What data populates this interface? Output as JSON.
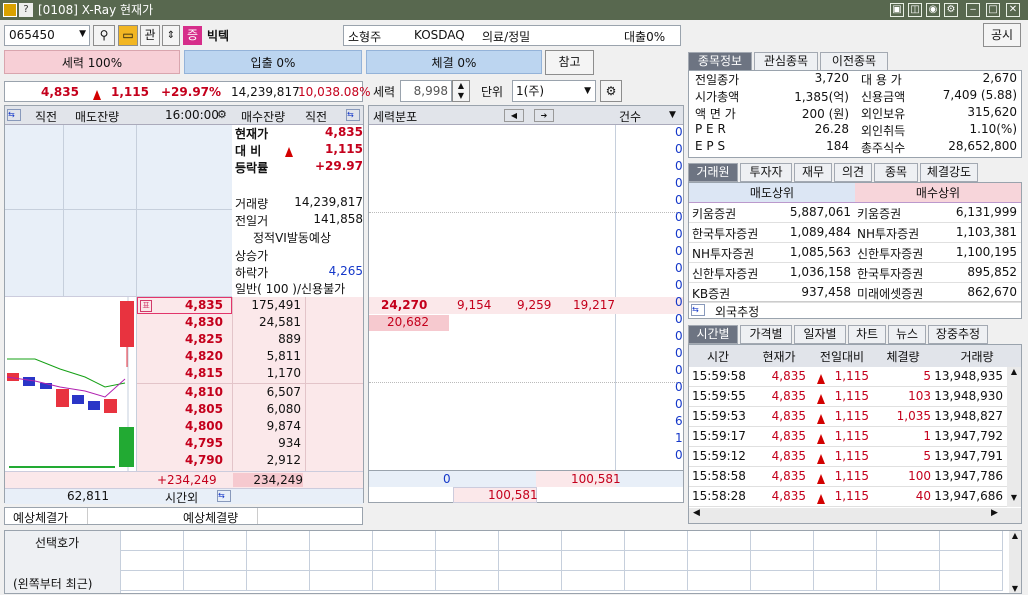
{
  "window": {
    "title": "[0108] X-Ray 현재가",
    "icon_q": "?"
  },
  "toolbar": {
    "code": "065450",
    "gwan": "관",
    "jeung": "증",
    "name": "빅텍",
    "size": "소형주",
    "market": "KOSDAQ",
    "sector": "의료/정밀",
    "loan": "대출0%",
    "notice_btn": "공시"
  },
  "bars": {
    "force": "세력 100%",
    "inout": "입출 0%",
    "fill": "체결 0%",
    "ref": "참고"
  },
  "price_line": {
    "price": "4,835",
    "change": "1,115",
    "rate": "+29.97%",
    "volume": "14,239,817",
    "vol_ratio": "10,038.08%"
  },
  "force_ctrl": {
    "label": "세력",
    "value": "8,998",
    "unit_label": "단위",
    "unit": "1(주)"
  },
  "orderbook": {
    "headers": {
      "prev_l": "직전",
      "sell_rem": "매도잔량",
      "time": "16:00:00",
      "buy_rem": "매수잔량",
      "prev_r": "직전"
    },
    "info": {
      "cur_l": "현재가",
      "cur_v": "4,835",
      "diff_l": "대 비",
      "diff_v": "1,115",
      "rate_l": "등락률",
      "rate_v": "+29.97",
      "vol_l": "거래량",
      "vol_v": "14,239,817",
      "prev_l": "전일거",
      "prev_v": "141,858",
      "vi": "정적VI발동예상",
      "upper_l": "상승가",
      "lower_l": "하락가",
      "lower_v": "4,265",
      "credit": "일반( 100 )/신용불가"
    },
    "asks_rows": [
      {
        "price": "4,835",
        "vol": "175,491",
        "mark": "표"
      },
      {
        "price": "4,830",
        "vol": "24,581"
      },
      {
        "price": "4,825",
        "vol": "889"
      },
      {
        "price": "4,820",
        "vol": "5,811"
      },
      {
        "price": "4,815",
        "vol": "1,170"
      },
      {
        "price": "4,810",
        "vol": "6,507"
      },
      {
        "price": "4,805",
        "vol": "6,080"
      },
      {
        "price": "4,800",
        "vol": "9,874"
      },
      {
        "price": "4,795",
        "vol": "934"
      },
      {
        "price": "4,790",
        "vol": "2,912"
      }
    ],
    "foot": {
      "net": "+234,249",
      "buy_total": "234,249",
      "sell_total": "62,811",
      "after": "시간외"
    }
  },
  "force_dist": {
    "title": "세력분포",
    "cnt": "건수",
    "row1": [
      "24,270",
      "9,154",
      "9,259",
      "19,217"
    ],
    "row2": "20,682",
    "zeros": [
      "0",
      "0",
      "0",
      "0",
      "0",
      "0",
      "0",
      "0",
      "0",
      "0",
      "0",
      "0",
      "0",
      "0",
      "0",
      "0",
      "0",
      "6",
      "1",
      "0"
    ],
    "bottom": {
      "a": "0",
      "b": "100,581",
      "c": "100,581"
    }
  },
  "expected": {
    "result": "예상체결가",
    "qty": "예상체결량"
  },
  "stock_info": {
    "tabs": [
      "종목정보",
      "관심종목",
      "이전종목"
    ],
    "left": [
      {
        "k": "전일종가",
        "v": "3,720"
      },
      {
        "k": "시가총액",
        "v": "1,385(억)"
      },
      {
        "k": "액 면 가",
        "v": "200 (원)"
      },
      {
        "k": "P E R",
        "v": "26.28"
      },
      {
        "k": "E P S",
        "v": "184"
      }
    ],
    "right": [
      {
        "k": "대 용 가",
        "v": "2,670"
      },
      {
        "k": "신용금액",
        "v": "7,409  (5.88)"
      },
      {
        "k": "외인보유",
        "v": "315,620"
      },
      {
        "k": "외인취득",
        "v": "1.10(%)"
      },
      {
        "k": "총주식수",
        "v": "28,652,800"
      }
    ]
  },
  "broker": {
    "tabs": [
      "거래원",
      "투자자",
      "재무",
      "의견",
      "종목",
      "체결강도"
    ],
    "sell_hdr": "매도상위",
    "buy_hdr": "매수상위",
    "rows": [
      {
        "s": "키움증권",
        "sv": "5,887,061",
        "b": "키움증권",
        "bv": "6,131,999"
      },
      {
        "s": "한국투자증권",
        "sv": "1,089,484",
        "b": "NH투자증권",
        "bv": "1,103,381"
      },
      {
        "s": "NH투자증권",
        "sv": "1,085,563",
        "b": "신한투자증권",
        "bv": "1,100,195"
      },
      {
        "s": "신한투자증권",
        "sv": "1,036,158",
        "b": "한국투자증권",
        "bv": "895,852"
      },
      {
        "s": "KB증권",
        "sv": "937,458",
        "b": "미래에셋증권",
        "bv": "862,670"
      }
    ],
    "foreign": "외국추정"
  },
  "ticks": {
    "tabs": [
      "시간별",
      "가격별",
      "일자별",
      "차트",
      "뉴스",
      "장중추정"
    ],
    "headers": [
      "시간",
      "현재가",
      "전일대비",
      "체결량",
      "거래량"
    ],
    "rows": [
      {
        "t": "15:59:58",
        "p": "4,835",
        "d": "1,115",
        "q": "5",
        "v": "13,948,935"
      },
      {
        "t": "15:59:55",
        "p": "4,835",
        "d": "1,115",
        "q": "103",
        "v": "13,948,930"
      },
      {
        "t": "15:59:53",
        "p": "4,835",
        "d": "1,115",
        "q": "1,035",
        "v": "13,948,827"
      },
      {
        "t": "15:59:17",
        "p": "4,835",
        "d": "1,115",
        "q": "1",
        "v": "13,947,792"
      },
      {
        "t": "15:59:12",
        "p": "4,835",
        "d": "1,115",
        "q": "5",
        "v": "13,947,791"
      },
      {
        "t": "15:58:58",
        "p": "4,835",
        "d": "1,115",
        "q": "100",
        "v": "13,947,786"
      },
      {
        "t": "15:58:28",
        "p": "4,835",
        "d": "1,115",
        "q": "40",
        "v": "13,947,686"
      }
    ]
  },
  "bottom": {
    "sel_label": "선택호가",
    "note": "(왼쪽부터 최근)"
  }
}
